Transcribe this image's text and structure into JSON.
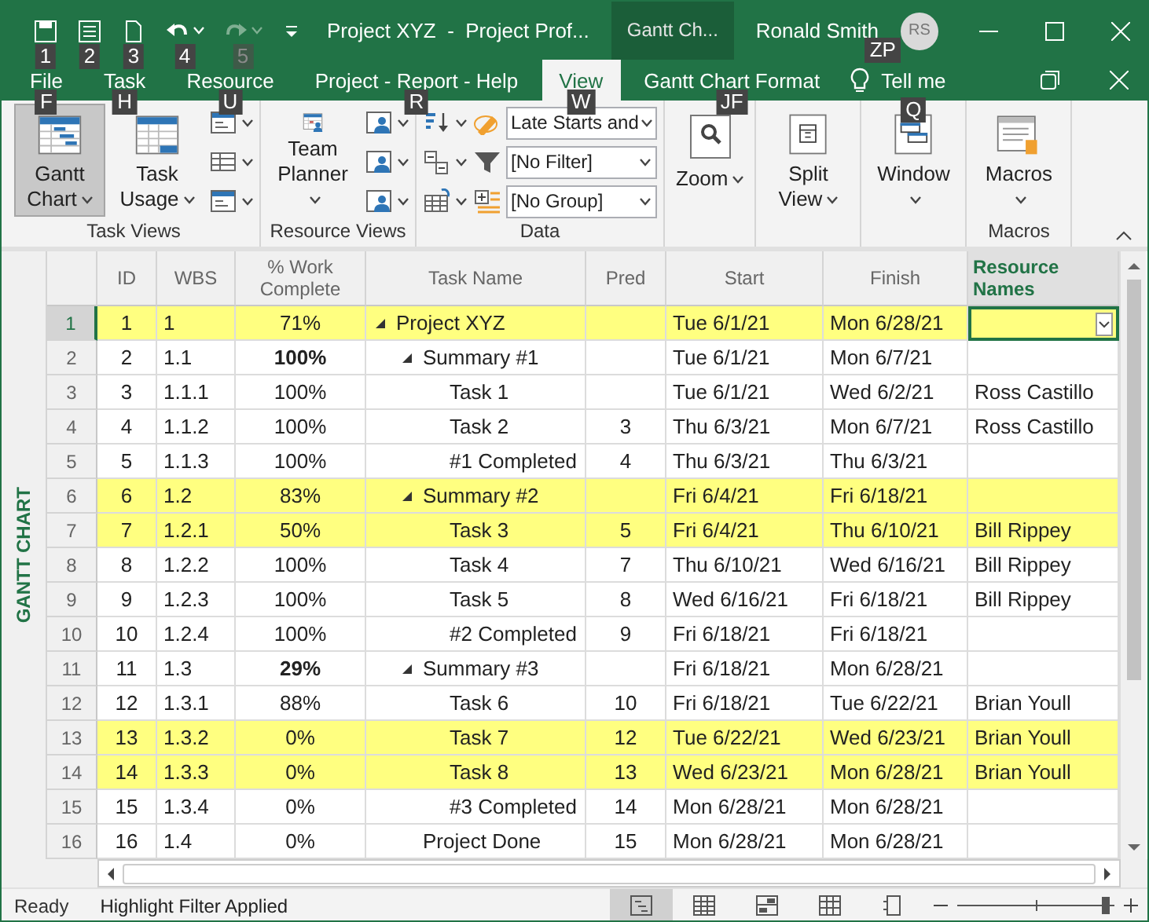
{
  "title_bar": {
    "quick_access": [
      {
        "keytip": "1",
        "disabled": false
      },
      {
        "keytip": "2",
        "disabled": false
      },
      {
        "keytip": "3",
        "disabled": false
      },
      {
        "keytip": "4",
        "disabled": false
      },
      {
        "keytip": "5",
        "disabled": true
      }
    ],
    "title": "Project XYZ  -  Project Prof...",
    "context_tab": "Gantt Ch...",
    "user": {
      "name": "Ronald Smith",
      "keytip": "ZP",
      "initials": "RS"
    }
  },
  "tabs": [
    {
      "label": "File",
      "keytip": "F",
      "selected": false
    },
    {
      "label": "Task",
      "keytip": "H",
      "selected": false
    },
    {
      "label": "Resource",
      "keytip": "U",
      "selected": false
    },
    {
      "label": "Project - Report - Help",
      "keytip": "R",
      "selected": false
    },
    {
      "label": "View",
      "keytip": "W",
      "selected": true
    },
    {
      "label": "Gantt Chart Format",
      "keytip": "JF",
      "selected": false
    }
  ],
  "tell_me": {
    "label": "Tell me",
    "keytip": "Q"
  },
  "ribbon": {
    "groups": [
      {
        "label": "Task Views",
        "buttons": [
          {
            "label": "Gantt Chart",
            "selected": true
          },
          {
            "label": "Task Usage",
            "selected": false
          }
        ]
      },
      {
        "label": "Resource Views",
        "buttons": [
          {
            "label": "Team Planner",
            "selected": false
          }
        ]
      },
      {
        "label": "Data",
        "combos": [
          {
            "value": "Late Starts and"
          },
          {
            "value": "[No Filter]"
          },
          {
            "value": "[No Group]"
          }
        ]
      },
      {
        "buttons": [
          {
            "label": "Zoom",
            "selected": false
          }
        ]
      },
      {
        "buttons": [
          {
            "label": "Split View",
            "selected": false
          }
        ]
      },
      {
        "buttons": [
          {
            "label": "Window",
            "selected": false
          }
        ]
      },
      {
        "label": "Macros",
        "buttons": [
          {
            "label": "Macros",
            "selected": false
          }
        ]
      }
    ]
  },
  "view_bar_label": "GANTT CHART",
  "table": {
    "columns": [
      {
        "label": "ID",
        "selected": false
      },
      {
        "label": "WBS",
        "selected": false
      },
      {
        "label": "% Work Complete",
        "selected": false
      },
      {
        "label": "Task Name",
        "selected": false
      },
      {
        "label": "Pred",
        "selected": false
      },
      {
        "label": "Start",
        "selected": false
      },
      {
        "label": "Finish",
        "selected": false
      },
      {
        "label": "Resource Names",
        "selected": true
      }
    ],
    "rows": [
      {
        "row_number": "1",
        "id": "1",
        "wbs": "1",
        "work_complete": "71%",
        "work_complete_bold": false,
        "name": "Project XYZ",
        "start": "Tue 6/1/21",
        "finish": "Mon 6/28/21",
        "highlighted": true,
        "selected": true,
        "expanded": true,
        "children": [
          {
            "row_number": "2",
            "id": "2",
            "wbs": "1.1",
            "work_complete": "100%",
            "work_complete_bold": true,
            "name": "Summary #1",
            "start": "Tue 6/1/21",
            "finish": "Mon 6/7/21",
            "highlighted": false,
            "selected": false,
            "expanded": true,
            "children": [
              {
                "row_number": "3",
                "id": "3",
                "wbs": "1.1.1",
                "work_complete": "100%",
                "work_complete_bold": false,
                "name": "Task 1",
                "start": "Tue 6/1/21",
                "finish": "Wed 6/2/21",
                "resource": "Ross Castillo",
                "highlighted": false,
                "selected": false
              },
              {
                "row_number": "4",
                "id": "4",
                "wbs": "1.1.2",
                "work_complete": "100%",
                "work_complete_bold": false,
                "name": "Task 2",
                "pred": "3",
                "start": "Thu 6/3/21",
                "finish": "Mon 6/7/21",
                "resource": "Ross Castillo",
                "highlighted": false,
                "selected": false
              },
              {
                "row_number": "5",
                "id": "5",
                "wbs": "1.1.3",
                "work_complete": "100%",
                "work_complete_bold": false,
                "name": "#1 Completed",
                "pred": "4",
                "start": "Thu 6/3/21",
                "finish": "Thu 6/3/21",
                "highlighted": false,
                "selected": false
              }
            ]
          },
          {
            "row_number": "6",
            "id": "6",
            "wbs": "1.2",
            "work_complete": "83%",
            "work_complete_bold": false,
            "name": "Summary #2",
            "start": "Fri 6/4/21",
            "finish": "Fri 6/18/21",
            "highlighted": true,
            "selected": false,
            "expanded": true,
            "children": [
              {
                "row_number": "7",
                "id": "7",
                "wbs": "1.2.1",
                "work_complete": "50%",
                "work_complete_bold": false,
                "name": "Task 3",
                "pred": "5",
                "start": "Fri 6/4/21",
                "finish": "Thu 6/10/21",
                "resource": "Bill Rippey",
                "highlighted": true,
                "selected": false
              },
              {
                "row_number": "8",
                "id": "8",
                "wbs": "1.2.2",
                "work_complete": "100%",
                "work_complete_bold": false,
                "name": "Task 4",
                "pred": "7",
                "start": "Thu 6/10/21",
                "finish": "Wed 6/16/21",
                "resource": "Bill Rippey",
                "highlighted": false,
                "selected": false
              },
              {
                "row_number": "9",
                "id": "9",
                "wbs": "1.2.3",
                "work_complete": "100%",
                "work_complete_bold": false,
                "name": "Task 5",
                "pred": "8",
                "start": "Wed 6/16/21",
                "finish": "Fri 6/18/21",
                "resource": "Bill Rippey",
                "highlighted": false,
                "selected": false
              },
              {
                "row_number": "10",
                "id": "10",
                "wbs": "1.2.4",
                "work_complete": "100%",
                "work_complete_bold": false,
                "name": "#2 Completed",
                "pred": "9",
                "start": "Fri 6/18/21",
                "finish": "Fri 6/18/21",
                "highlighted": false,
                "selected": false
              }
            ]
          },
          {
            "row_number": "11",
            "id": "11",
            "wbs": "1.3",
            "work_complete": "29%",
            "work_complete_bold": true,
            "name": "Summary #3",
            "start": "Fri 6/18/21",
            "finish": "Mon 6/28/21",
            "highlighted": false,
            "selected": false,
            "expanded": true,
            "children": [
              {
                "row_number": "12",
                "id": "12",
                "wbs": "1.3.1",
                "work_complete": "88%",
                "work_complete_bold": false,
                "name": "Task 6",
                "pred": "10",
                "start": "Fri 6/18/21",
                "finish": "Tue 6/22/21",
                "resource": "Brian Youll",
                "highlighted": false,
                "selected": false
              },
              {
                "row_number": "13",
                "id": "13",
                "wbs": "1.3.2",
                "work_complete": "0%",
                "work_complete_bold": false,
                "name": "Task 7",
                "pred": "12",
                "start": "Tue 6/22/21",
                "finish": "Wed 6/23/21",
                "resource": "Brian Youll",
                "highlighted": true,
                "selected": false
              },
              {
                "row_number": "14",
                "id": "14",
                "wbs": "1.3.3",
                "work_complete": "0%",
                "work_complete_bold": false,
                "name": "Task 8",
                "pred": "13",
                "start": "Wed 6/23/21",
                "finish": "Mon 6/28/21",
                "resource": "Brian Youll",
                "highlighted": true,
                "selected": false
              },
              {
                "row_number": "15",
                "id": "15",
                "wbs": "1.3.4",
                "work_complete": "0%",
                "work_complete_bold": false,
                "name": "#3 Completed",
                "pred": "14",
                "start": "Mon 6/28/21",
                "finish": "Mon 6/28/21",
                "highlighted": false,
                "selected": false
              }
            ]
          },
          {
            "row_number": "16",
            "id": "16",
            "wbs": "1.4",
            "work_complete": "0%",
            "work_complete_bold": false,
            "name": "Project Done",
            "pred": "15",
            "start": "Mon 6/28/21",
            "finish": "Mon 6/28/21",
            "highlighted": false,
            "selected": false
          }
        ]
      }
    ]
  },
  "status_bar": {
    "ready": "Ready",
    "filter": "Highlight Filter Applied",
    "views": [
      {
        "selected": true
      },
      {
        "selected": false
      },
      {
        "selected": false
      },
      {
        "selected": false
      },
      {
        "selected": false
      }
    ],
    "zoom": {
      "level": 0.95
    }
  }
}
